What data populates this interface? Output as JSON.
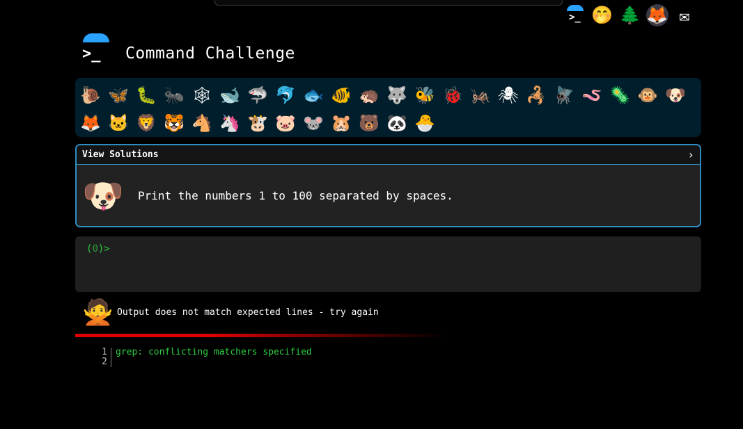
{
  "app": {
    "title": "Command Challenge"
  },
  "top_icons": [
    {
      "name": "command-challenge-icon",
      "glyph": ">_"
    },
    {
      "name": "hand-over-mouth-icon",
      "glyph": "🤭"
    },
    {
      "name": "evergreen-tree-icon",
      "glyph": "🌲"
    },
    {
      "name": "gitlab-icon",
      "glyph": "🦊"
    },
    {
      "name": "envelope-icon",
      "glyph": "✉"
    }
  ],
  "animals_row1": [
    "🐌",
    "🦋",
    "🐛",
    "🐜",
    "🕸",
    "🐋",
    "🦈",
    "🐬",
    "🐟",
    "🐠",
    "🦔",
    "🐺",
    "🐝",
    "🐞",
    "🦗",
    "🕷",
    "🦂",
    "🪰",
    "🪱",
    "🦠",
    "🐵",
    "🐶"
  ],
  "animals_row2": [
    "🦊",
    "🐱",
    "🦁",
    "🐯",
    "🐴",
    "🦄",
    "🐮",
    "🐷",
    "🐭",
    "🐹",
    "🐻",
    "🐼",
    "🐣"
  ],
  "task": {
    "header_label": "View Solutions",
    "chevron": "›",
    "icon": "🐶",
    "text": "Print the numbers 1 to 100 separated by spaces."
  },
  "terminal": {
    "prompt_open": "(",
    "count": "0",
    "prompt_close": ")>"
  },
  "result": {
    "icon": "🙅",
    "message": "Output does not match expected lines - try again"
  },
  "output": {
    "lines": [
      {
        "num": "1",
        "text": "grep: conflicting matchers specified"
      },
      {
        "num": "2",
        "text": ""
      }
    ]
  },
  "colors": {
    "accent": "#29a3ff",
    "task_border": "#2f8cc0",
    "terminal_green": "#2ecc40",
    "error_red": "#e00000",
    "animal_bar": "#001e2b"
  }
}
